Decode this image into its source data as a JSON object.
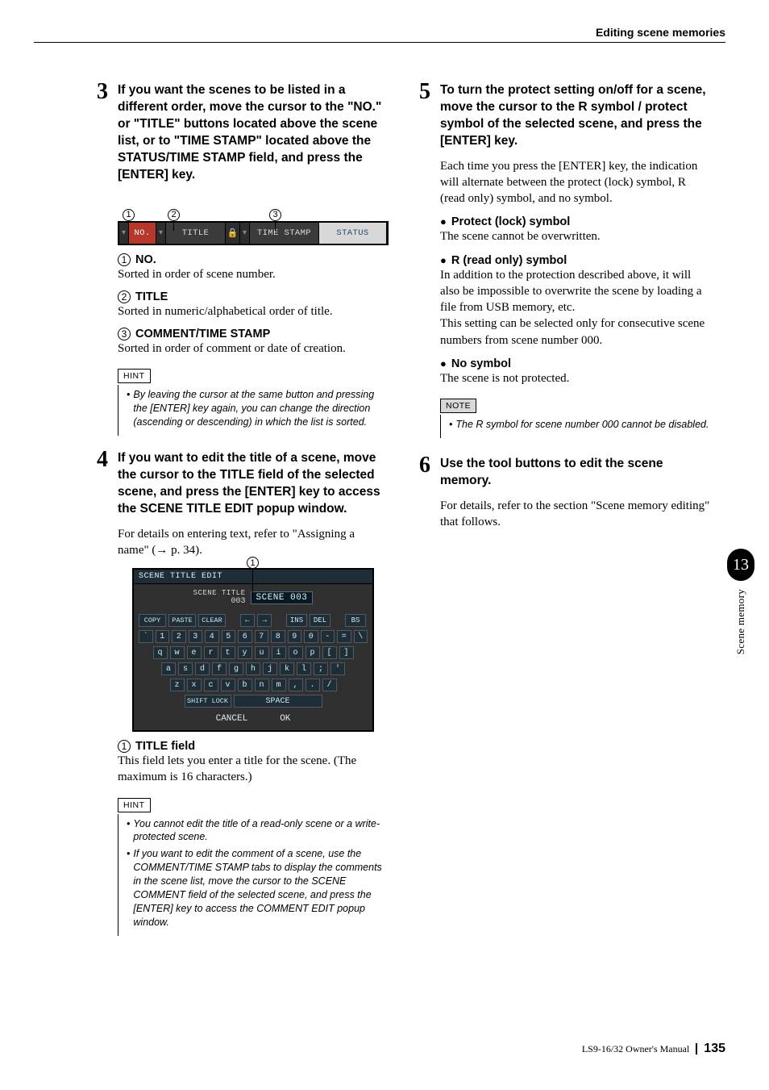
{
  "running_head": "Editing scene memories",
  "side": {
    "chapter": "13",
    "label": "Scene memory"
  },
  "footer": {
    "manual": "LS9-16/32  Owner's Manual",
    "page": "135"
  },
  "left": {
    "step3": {
      "num": "3",
      "title": "If you want the scenes to be listed in a different order, move the cursor to the \"NO.\" or \"TITLE\" buttons located above the scene list, or to \"TIME STAMP\" located above the STATUS/TIME STAMP field, and press the [ENTER] key."
    },
    "fig1": {
      "callouts": [
        "1",
        "2",
        "3"
      ],
      "cells": {
        "no": "NO.",
        "title": "TITLE",
        "timestamp": "TIME STAMP",
        "status": "STATUS"
      }
    },
    "sub1": {
      "num": "1",
      "label": "NO.",
      "text": "Sorted in order of scene number."
    },
    "sub2": {
      "num": "2",
      "label": "TITLE",
      "text": "Sorted in numeric/alphabetical order of title."
    },
    "sub3": {
      "num": "3",
      "label": "COMMENT/TIME STAMP",
      "text": "Sorted in order of comment or date of creation."
    },
    "hint1": {
      "tab": "HINT",
      "items": [
        "By leaving the cursor at the same button and pressing the [ENTER] key again, you can change the direction (ascending or descending) in which the list is sorted."
      ]
    },
    "step4": {
      "num": "4",
      "title": "If you want to edit the title of a scene, move the cursor to the TITLE field of the selected scene, and press the [ENTER] key to access the SCENE TITLE EDIT popup window.",
      "para": "For details on entering text, refer to \"Assigning a name\" (→ p. 34)."
    },
    "fig2": {
      "callout": "1",
      "header": "SCENE TITLE EDIT",
      "scene_label": "SCENE TITLE",
      "scene_no": "003",
      "scene_name": "SCENE 003",
      "row_actions": [
        "COPY",
        "PASTE",
        "CLEAR",
        "",
        "←",
        "→",
        "",
        "INS",
        "DEL",
        "",
        "BS"
      ],
      "row_nums": [
        "`",
        "1",
        "2",
        "3",
        "4",
        "5",
        "6",
        "7",
        "8",
        "9",
        "0",
        "-",
        "=",
        "\\"
      ],
      "row_q": [
        "q",
        "w",
        "e",
        "r",
        "t",
        "y",
        "u",
        "i",
        "o",
        "p",
        "[",
        "]"
      ],
      "row_a": [
        "a",
        "s",
        "d",
        "f",
        "g",
        "h",
        "j",
        "k",
        "l",
        ";",
        "'"
      ],
      "row_z": [
        "z",
        "x",
        "c",
        "v",
        "b",
        "n",
        "m",
        ",",
        ".",
        "/"
      ],
      "shift": "SHIFT LOCK",
      "space": "SPACE",
      "cancel": "CANCEL",
      "ok": "OK"
    },
    "sub_title_field": {
      "num": "1",
      "label": "TITLE field",
      "text": "This field lets you enter a title for the scene. (The maximum is 16 characters.)"
    },
    "hint2": {
      "tab": "HINT",
      "items": [
        "You cannot edit the title of a read-only scene or a write-protected scene.",
        "If you want to edit the comment of a scene, use the COMMENT/TIME STAMP tabs to display the comments in the scene list, move the cursor to the SCENE COMMENT field of the selected scene, and press the [ENTER] key to access the COMMENT EDIT popup window."
      ]
    }
  },
  "right": {
    "step5": {
      "num": "5",
      "title": "To turn the protect setting on/off for a scene, move the cursor to the R symbol / protect symbol of the selected scene, and press the [ENTER] key.",
      "para": "Each time you press the [ENTER] key, the indication will alternate between the protect (lock) symbol, R (read only) symbol, and no symbol."
    },
    "b1": {
      "label": "Protect (lock) symbol",
      "text": "The scene cannot be overwritten."
    },
    "b2": {
      "label": "R (read only) symbol",
      "text1": "In addition to the protection described above, it will also be impossible to overwrite the scene by loading a file from USB memory, etc.",
      "text2": "This setting can be selected only for consecutive scene numbers from scene number 000."
    },
    "b3": {
      "label": "No symbol",
      "text": "The scene is not protected."
    },
    "note": {
      "tab": "NOTE",
      "items": [
        "The R symbol for scene number 000 cannot be disabled."
      ]
    },
    "step6": {
      "num": "6",
      "title": "Use the tool buttons to edit the scene memory.",
      "para": "For details, refer to the section \"Scene memory editing\" that follows."
    }
  }
}
